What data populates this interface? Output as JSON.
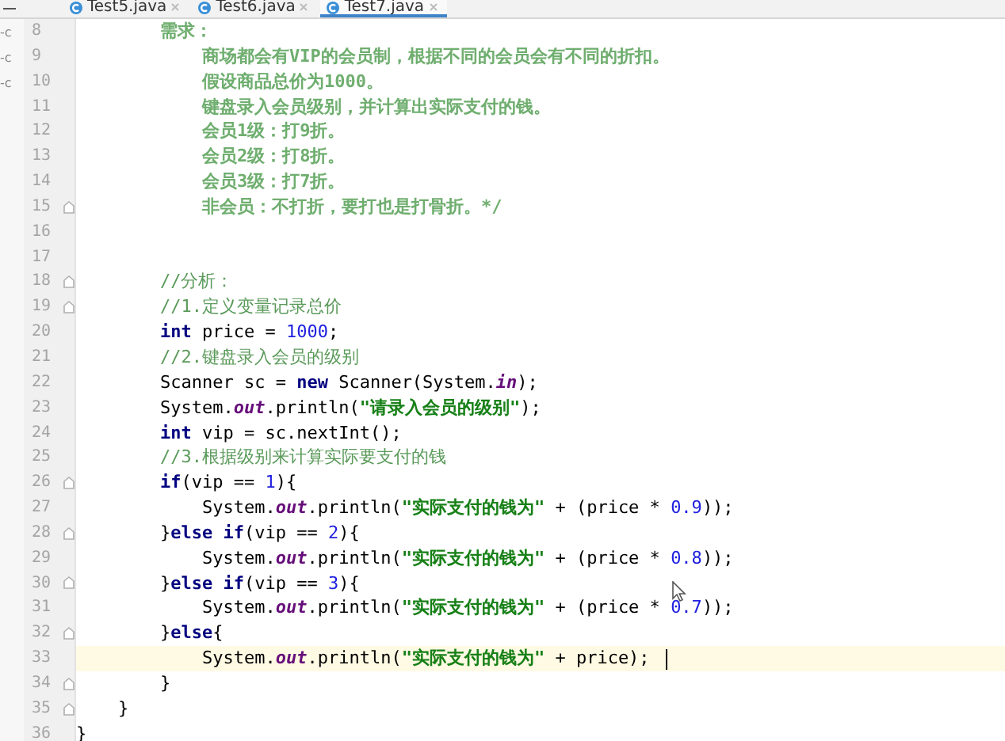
{
  "tabs": [
    {
      "label": "Test5.java",
      "selected": false
    },
    {
      "label": "Test6.java",
      "selected": false
    },
    {
      "label": "Test7.java",
      "selected": true
    }
  ],
  "project_panel": [
    "-c",
    "-c",
    "-c"
  ],
  "lines": [
    {
      "number": "8",
      "fold": false,
      "current": false,
      "caret": false,
      "tokens": [
        {
          "kind": "doc",
          "text": "        需求："
        }
      ]
    },
    {
      "number": "9",
      "fold": false,
      "current": false,
      "caret": false,
      "tokens": [
        {
          "kind": "doc",
          "text": "            商场都会有VIP的会员制，根据不同的会员会有不同的折扣。"
        }
      ]
    },
    {
      "number": "10",
      "fold": false,
      "current": false,
      "caret": false,
      "tokens": [
        {
          "kind": "doc",
          "text": "            假设商品总价为1000。"
        }
      ]
    },
    {
      "number": "11",
      "fold": false,
      "current": false,
      "caret": false,
      "tokens": [
        {
          "kind": "doc",
          "text": "            键盘录入会员级别，并计算出实际支付的钱。"
        }
      ]
    },
    {
      "number": "12",
      "fold": false,
      "current": false,
      "caret": false,
      "tokens": [
        {
          "kind": "doc",
          "text": "            会员1级：打9折。"
        }
      ]
    },
    {
      "number": "13",
      "fold": false,
      "current": false,
      "caret": false,
      "tokens": [
        {
          "kind": "doc",
          "text": "            会员2级：打8折。"
        }
      ]
    },
    {
      "number": "14",
      "fold": false,
      "current": false,
      "caret": false,
      "tokens": [
        {
          "kind": "doc",
          "text": "            会员3级：打7折。"
        }
      ]
    },
    {
      "number": "15",
      "fold": true,
      "current": false,
      "caret": false,
      "tokens": [
        {
          "kind": "doc",
          "text": "            非会员：不打折，要打也是打骨折。*/"
        }
      ]
    },
    {
      "number": "16",
      "fold": false,
      "current": false,
      "caret": false
    },
    {
      "number": "17",
      "fold": false,
      "current": false,
      "caret": false
    },
    {
      "number": "18",
      "fold": true,
      "current": false,
      "caret": false,
      "tokens": [
        {
          "kind": "comment",
          "text": "        //分析："
        }
      ]
    },
    {
      "number": "19",
      "fold": true,
      "current": false,
      "caret": false,
      "tokens": [
        {
          "kind": "comment",
          "text": "        //1.定义变量记录总价"
        }
      ]
    },
    {
      "number": "20",
      "fold": false,
      "current": false,
      "caret": false,
      "tokens": [
        {
          "kind": "keyword",
          "text": "        int"
        },
        {
          "kind": "plain",
          "text": " price = "
        },
        {
          "kind": "number",
          "text": "1000"
        },
        {
          "kind": "plain",
          "text": ";"
        }
      ]
    },
    {
      "number": "21",
      "fold": false,
      "current": false,
      "caret": false,
      "tokens": [
        {
          "kind": "comment",
          "text": "        //2.键盘录入会员的级别"
        }
      ]
    },
    {
      "number": "22",
      "fold": false,
      "current": false,
      "caret": false,
      "tokens": [
        {
          "kind": "plain",
          "text": "        Scanner sc = "
        },
        {
          "kind": "keyword",
          "text": "new"
        },
        {
          "kind": "plain",
          "text": " Scanner(System."
        },
        {
          "kind": "field",
          "text": "in"
        },
        {
          "kind": "plain",
          "text": ");"
        }
      ]
    },
    {
      "number": "23",
      "fold": false,
      "current": false,
      "caret": false,
      "tokens": [
        {
          "kind": "plain",
          "text": "        System."
        },
        {
          "kind": "field",
          "text": "out"
        },
        {
          "kind": "plain",
          "text": ".println("
        },
        {
          "kind": "string",
          "text": "\"请录入会员的级别\""
        },
        {
          "kind": "plain",
          "text": ");"
        }
      ]
    },
    {
      "number": "24",
      "fold": false,
      "current": false,
      "caret": false,
      "tokens": [
        {
          "kind": "keyword",
          "text": "        int"
        },
        {
          "kind": "plain",
          "text": " vip = sc.nextInt();"
        }
      ]
    },
    {
      "number": "25",
      "fold": false,
      "current": false,
      "caret": false,
      "tokens": [
        {
          "kind": "comment",
          "text": "        //3.根据级别来计算实际要支付的钱"
        }
      ]
    },
    {
      "number": "26",
      "fold": true,
      "current": false,
      "caret": false,
      "tokens": [
        {
          "kind": "keyword",
          "text": "        if"
        },
        {
          "kind": "plain",
          "text": "(vip == "
        },
        {
          "kind": "number",
          "text": "1"
        },
        {
          "kind": "plain",
          "text": "){"
        }
      ]
    },
    {
      "number": "27",
      "fold": false,
      "current": false,
      "caret": false,
      "tokens": [
        {
          "kind": "plain",
          "text": "            System."
        },
        {
          "kind": "field",
          "text": "out"
        },
        {
          "kind": "plain",
          "text": ".println("
        },
        {
          "kind": "string",
          "text": "\"实际支付的钱为\""
        },
        {
          "kind": "plain",
          "text": " + (price * "
        },
        {
          "kind": "number",
          "text": "0.9"
        },
        {
          "kind": "plain",
          "text": "));"
        }
      ]
    },
    {
      "number": "28",
      "fold": true,
      "current": false,
      "caret": false,
      "tokens": [
        {
          "kind": "plain",
          "text": "        }"
        },
        {
          "kind": "keyword",
          "text": "else if"
        },
        {
          "kind": "plain",
          "text": "(vip == "
        },
        {
          "kind": "number",
          "text": "2"
        },
        {
          "kind": "plain",
          "text": "){"
        }
      ]
    },
    {
      "number": "29",
      "fold": false,
      "current": false,
      "caret": false,
      "tokens": [
        {
          "kind": "plain",
          "text": "            System."
        },
        {
          "kind": "field",
          "text": "out"
        },
        {
          "kind": "plain",
          "text": ".println("
        },
        {
          "kind": "string",
          "text": "\"实际支付的钱为\""
        },
        {
          "kind": "plain",
          "text": " + (price * "
        },
        {
          "kind": "number",
          "text": "0.8"
        },
        {
          "kind": "plain",
          "text": "));"
        }
      ]
    },
    {
      "number": "30",
      "fold": true,
      "current": false,
      "caret": false,
      "tokens": [
        {
          "kind": "plain",
          "text": "        }"
        },
        {
          "kind": "keyword",
          "text": "else if"
        },
        {
          "kind": "plain",
          "text": "(vip == "
        },
        {
          "kind": "number",
          "text": "3"
        },
        {
          "kind": "plain",
          "text": "){"
        }
      ]
    },
    {
      "number": "31",
      "fold": false,
      "current": false,
      "caret": false,
      "tokens": [
        {
          "kind": "plain",
          "text": "            System."
        },
        {
          "kind": "field",
          "text": "out"
        },
        {
          "kind": "plain",
          "text": ".println("
        },
        {
          "kind": "string",
          "text": "\"实际支付的钱为\""
        },
        {
          "kind": "plain",
          "text": " + (price * "
        },
        {
          "kind": "number",
          "text": "0.7"
        },
        {
          "kind": "plain",
          "text": "));"
        }
      ]
    },
    {
      "number": "32",
      "fold": true,
      "current": false,
      "caret": false,
      "tokens": [
        {
          "kind": "plain",
          "text": "        }"
        },
        {
          "kind": "keyword",
          "text": "else"
        },
        {
          "kind": "plain",
          "text": "{"
        }
      ]
    },
    {
      "number": "33",
      "fold": false,
      "current": true,
      "caret": true,
      "tokens": [
        {
          "kind": "plain",
          "text": "            System."
        },
        {
          "kind": "field",
          "text": "out"
        },
        {
          "kind": "plain",
          "text": ".println("
        },
        {
          "kind": "string",
          "text": "\"实际支付的钱为\""
        },
        {
          "kind": "plain",
          "text": " + price);"
        }
      ]
    },
    {
      "number": "34",
      "fold": true,
      "current": false,
      "caret": false,
      "tokens": [
        {
          "kind": "plain",
          "text": "        }"
        }
      ]
    },
    {
      "number": "35",
      "fold": true,
      "current": false,
      "caret": false,
      "tokens": [
        {
          "kind": "plain",
          "text": "    }"
        }
      ]
    },
    {
      "number": "36",
      "fold": false,
      "current": false,
      "caret": false,
      "tokens": [
        {
          "kind": "plain",
          "text": "}"
        }
      ]
    }
  ]
}
